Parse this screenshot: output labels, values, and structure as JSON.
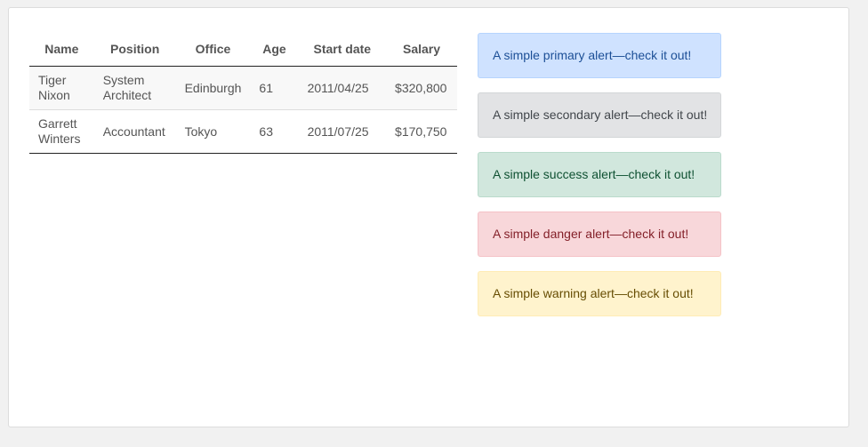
{
  "table": {
    "headers": [
      "Name",
      "Position",
      "Office",
      "Age",
      "Start date",
      "Salary"
    ],
    "rows": [
      {
        "name": "Tiger Nixon",
        "position": "System Architect",
        "office": "Edinburgh",
        "age": "61",
        "start_date": "2011/04/25",
        "salary": "$320,800"
      },
      {
        "name": "Garrett Winters",
        "position": "Accountant",
        "office": "Tokyo",
        "age": "63",
        "start_date": "2011/07/25",
        "salary": "$170,750"
      }
    ]
  },
  "alerts": {
    "primary": "A simple primary alert—check it out!",
    "secondary": "A simple secondary alert—check it out!",
    "success": "A simple success alert—check it out!",
    "danger": "A simple danger alert—check it out!",
    "warning": "A simple warning alert—check it out!"
  },
  "colors": {
    "page_bg": "#f1f1f1",
    "card_bg": "#ffffff",
    "primary_bg": "#cfe2ff",
    "secondary_bg": "#e2e3e5",
    "success_bg": "#d1e7dd",
    "danger_bg": "#f8d7da",
    "warning_bg": "#fff3cd"
  }
}
